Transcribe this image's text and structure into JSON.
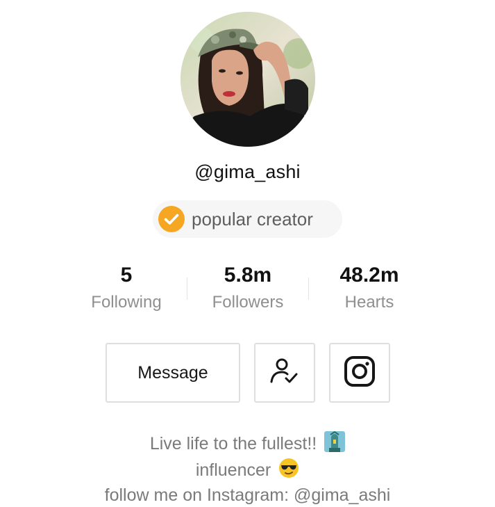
{
  "profile": {
    "username": "@gima_ashi",
    "badge": {
      "label": "popular creator",
      "icon": "checkmark-badge-icon",
      "color": "#f5a623"
    }
  },
  "stats": [
    {
      "value": "5",
      "label": "Following"
    },
    {
      "value": "5.8m",
      "label": "Followers"
    },
    {
      "value": "48.2m",
      "label": "Hearts"
    }
  ],
  "actions": {
    "message_label": "Message",
    "follow_icon": "user-check-icon",
    "instagram_icon": "instagram-icon"
  },
  "bio": {
    "line1": "Live life to the fullest!!",
    "line1_emoji": "statue-of-liberty-icon",
    "line2": "influencer",
    "line2_emoji": "sunglasses-emoji-icon",
    "line3": "follow me on Instagram: @gima_ashi"
  }
}
